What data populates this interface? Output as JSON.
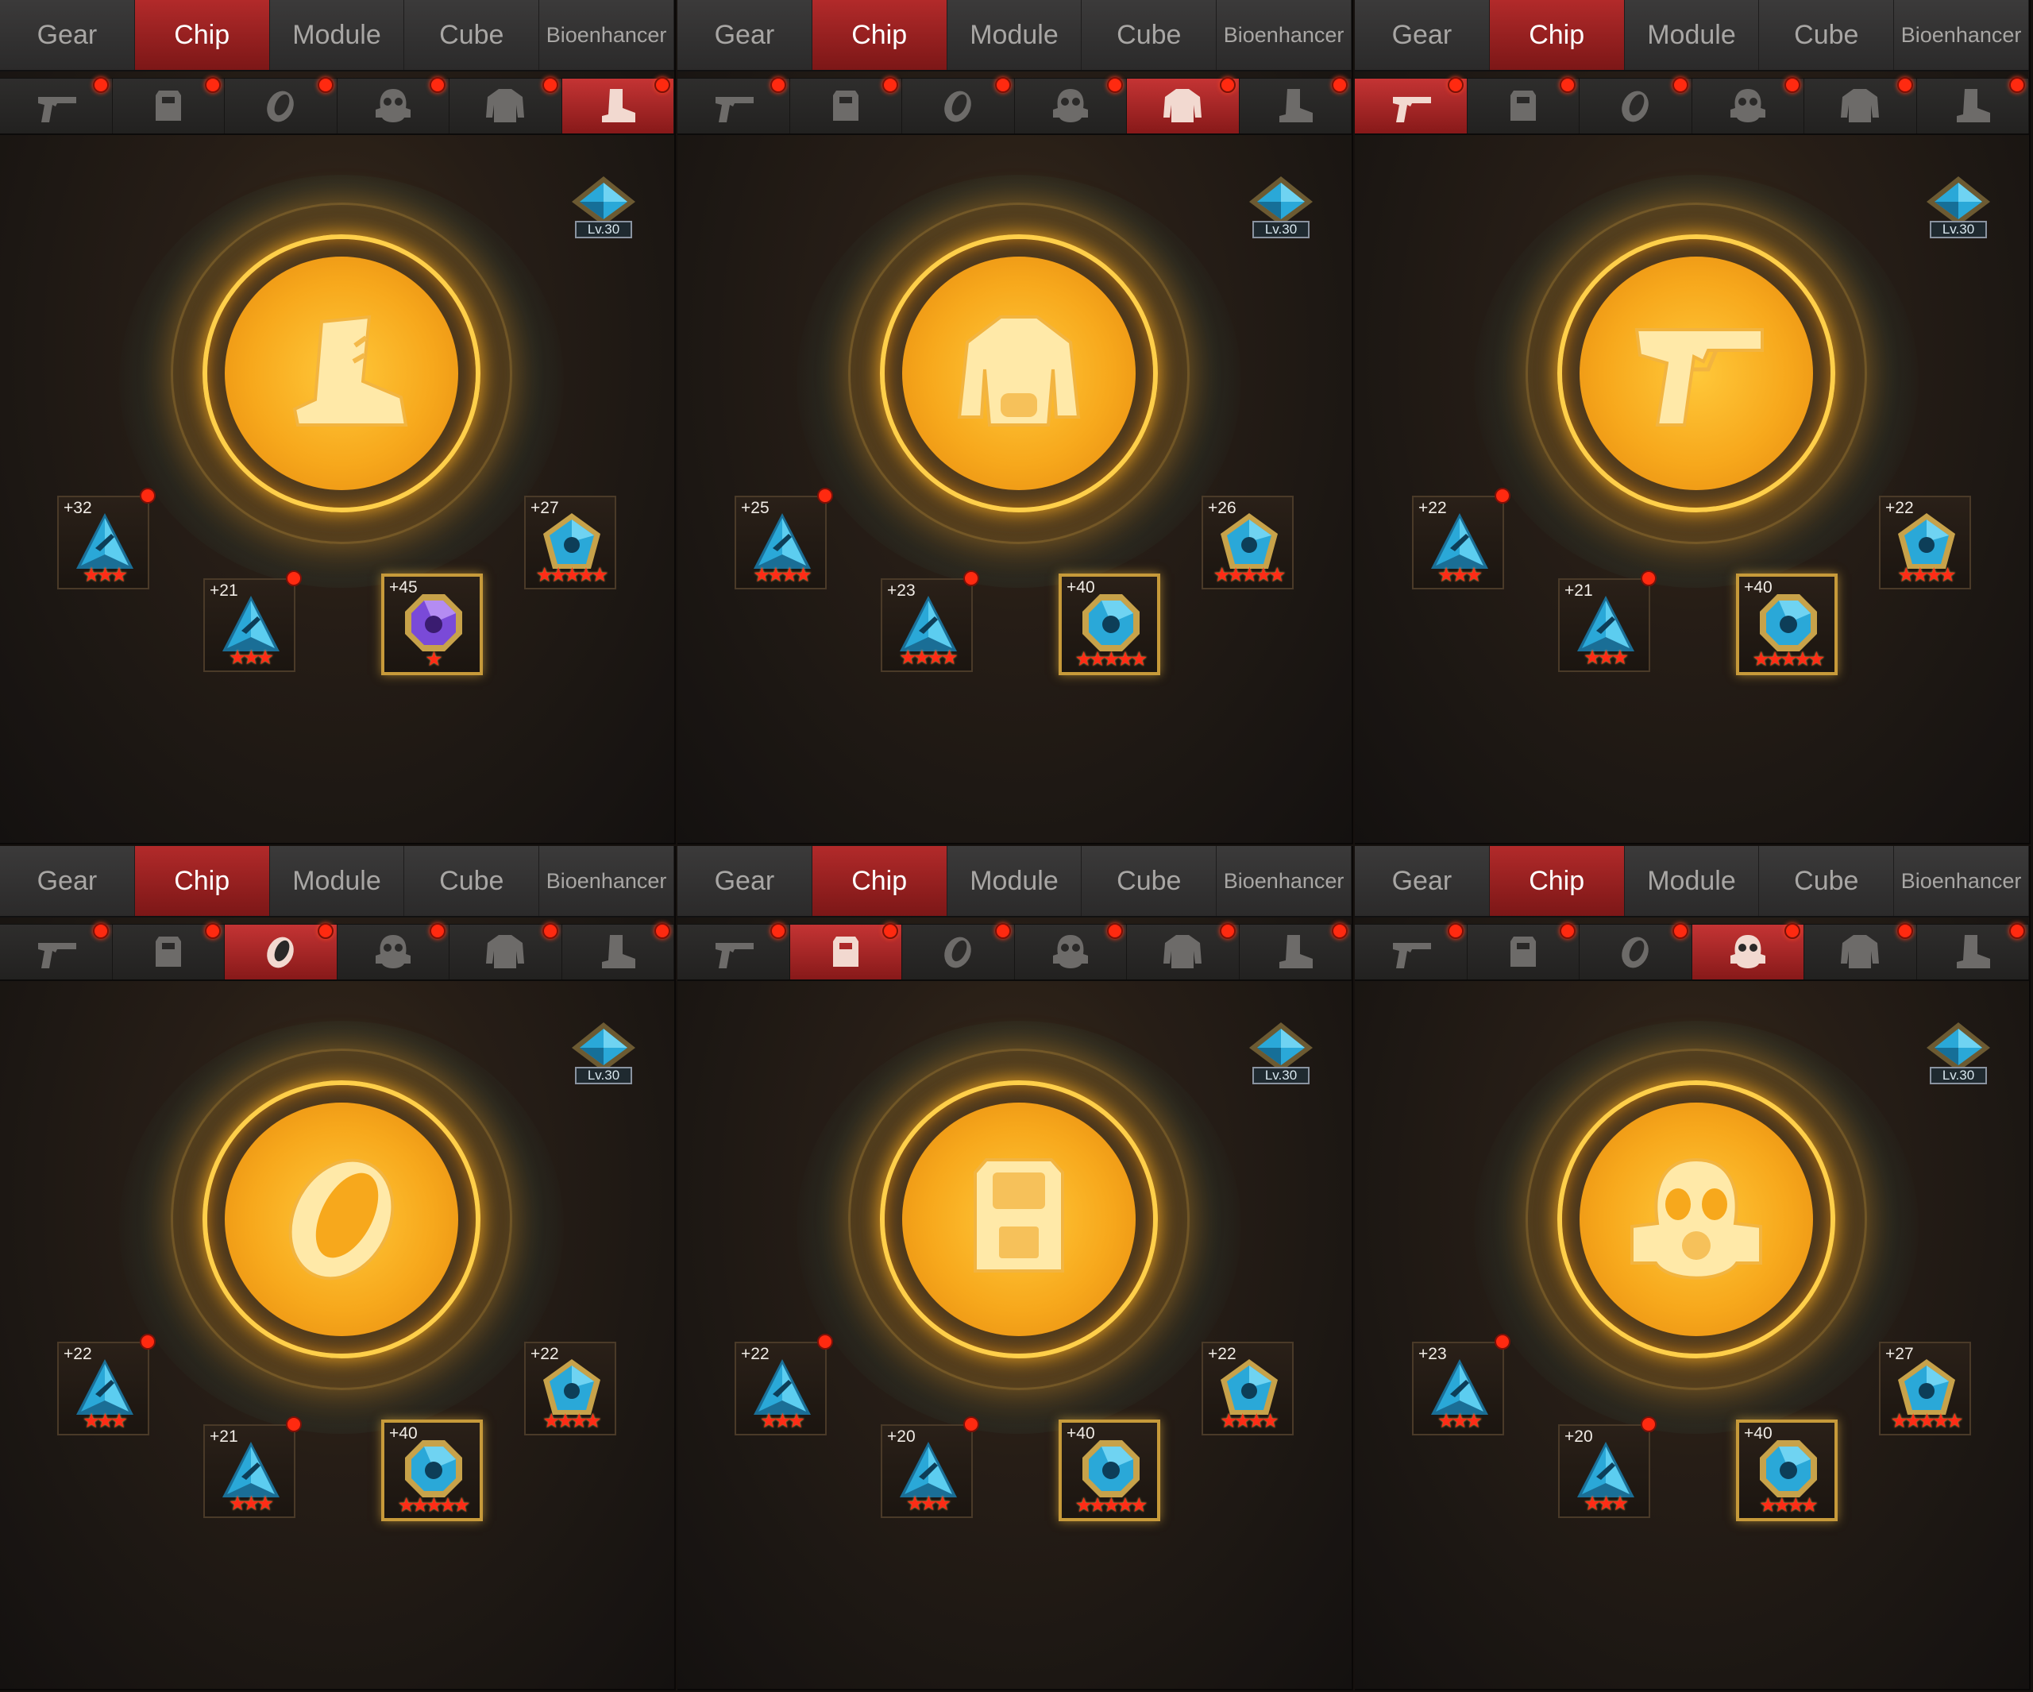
{
  "tabs": [
    "Gear",
    "Chip",
    "Module",
    "Cube",
    "Bioenhancer"
  ],
  "active_tab": 1,
  "slot_icons": [
    "pistol-icon",
    "vest-icon",
    "ring-icon",
    "gas-mask-icon",
    "jacket-icon",
    "boot-icon"
  ],
  "level_label": "Lv.30",
  "panels": [
    {
      "active_slot": 5,
      "center_icon": "boot-icon",
      "chips": [
        {
          "plus": "+32",
          "stars": 3,
          "gem": "blue-triangle",
          "dot": true
        },
        {
          "plus": "+21",
          "stars": 3,
          "gem": "blue-triangle",
          "dot": true
        },
        {
          "plus": "+45",
          "stars": 1,
          "gem": "purple-octagon",
          "dot": false
        },
        {
          "plus": "+27",
          "stars": 5,
          "gem": "blue-pentagon",
          "dot": false
        }
      ]
    },
    {
      "active_slot": 4,
      "center_icon": "jacket-icon",
      "chips": [
        {
          "plus": "+25",
          "stars": 4,
          "gem": "blue-triangle",
          "dot": true
        },
        {
          "plus": "+23",
          "stars": 4,
          "gem": "blue-triangle",
          "dot": true
        },
        {
          "plus": "+40",
          "stars": 5,
          "gem": "blue-octagon",
          "dot": false
        },
        {
          "plus": "+26",
          "stars": 5,
          "gem": "blue-pentagon",
          "dot": false
        }
      ]
    },
    {
      "active_slot": 0,
      "center_icon": "pistol-icon",
      "chips": [
        {
          "plus": "+22",
          "stars": 3,
          "gem": "blue-triangle",
          "dot": true
        },
        {
          "plus": "+21",
          "stars": 3,
          "gem": "blue-triangle",
          "dot": true
        },
        {
          "plus": "+40",
          "stars": 5,
          "gem": "blue-octagon",
          "dot": false
        },
        {
          "plus": "+22",
          "stars": 4,
          "gem": "blue-pentagon",
          "dot": false
        }
      ]
    },
    {
      "active_slot": 2,
      "center_icon": "ring-icon",
      "chips": [
        {
          "plus": "+22",
          "stars": 3,
          "gem": "blue-triangle",
          "dot": true
        },
        {
          "plus": "+21",
          "stars": 3,
          "gem": "blue-triangle",
          "dot": true
        },
        {
          "plus": "+40",
          "stars": 5,
          "gem": "blue-octagon",
          "dot": false
        },
        {
          "plus": "+22",
          "stars": 4,
          "gem": "blue-pentagon",
          "dot": false
        }
      ]
    },
    {
      "active_slot": 1,
      "center_icon": "vest-icon",
      "chips": [
        {
          "plus": "+22",
          "stars": 3,
          "gem": "blue-triangle",
          "dot": true
        },
        {
          "plus": "+20",
          "stars": 3,
          "gem": "blue-triangle",
          "dot": true
        },
        {
          "plus": "+40",
          "stars": 5,
          "gem": "blue-octagon",
          "dot": false
        },
        {
          "plus": "+22",
          "stars": 4,
          "gem": "blue-pentagon",
          "dot": false
        }
      ]
    },
    {
      "active_slot": 3,
      "center_icon": "gas-mask-icon",
      "chips": [
        {
          "plus": "+23",
          "stars": 3,
          "gem": "blue-triangle",
          "dot": true
        },
        {
          "plus": "+20",
          "stars": 3,
          "gem": "blue-triangle",
          "dot": true
        },
        {
          "plus": "+40",
          "stars": 4,
          "gem": "blue-octagon",
          "dot": false
        },
        {
          "plus": "+27",
          "stars": 5,
          "gem": "blue-pentagon",
          "dot": false
        }
      ]
    }
  ],
  "colors": {
    "accent": "#a82020",
    "glow": "#ffb020",
    "gem_blue": "#2aa8d8",
    "gem_purple": "#7a4ad8",
    "star": "#ff2c16"
  }
}
